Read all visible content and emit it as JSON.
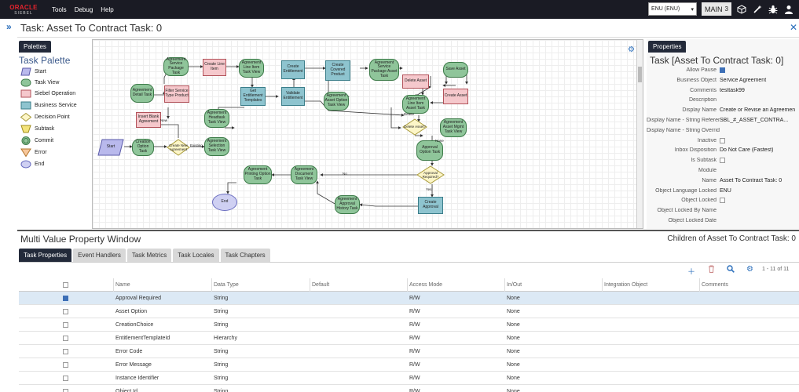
{
  "topbar": {
    "logo_line1": "ORACLE",
    "logo_line2": "SIEBEL",
    "menu": [
      "Tools",
      "Debug",
      "Help"
    ],
    "language": "ENU (ENU)",
    "main_label": "MAIN",
    "main_count": "3",
    "icons": [
      "cube-icon",
      "magic-wand-icon",
      "bug-icon",
      "user-icon"
    ]
  },
  "page": {
    "title": "Task: Asset To Contract Task: 0"
  },
  "palette": {
    "tab_label": "Palettes",
    "title": "Task Palette",
    "items": [
      {
        "label": "Start",
        "shape": "start"
      },
      {
        "label": "Task View",
        "shape": "taskview"
      },
      {
        "label": "Siebel Operation",
        "shape": "operation"
      },
      {
        "label": "Business Service",
        "shape": "service"
      },
      {
        "label": "Decision Point",
        "shape": "decision"
      },
      {
        "label": "Subtask",
        "shape": "subtask"
      },
      {
        "label": "Commit",
        "shape": "commit"
      },
      {
        "label": "Error",
        "shape": "error"
      },
      {
        "label": "End",
        "shape": "end"
      }
    ],
    "colors": {
      "taskview": "#8fc59a",
      "operation": "#f5c8cc",
      "service": "#8ec4cf",
      "decision": "#fdf6c8",
      "subtask": "#f3e37a",
      "error": "#f7c79b",
      "end": "#cfd0f2",
      "start": "#b9b9ec"
    }
  },
  "canvas": {
    "nodes": [
      {
        "id": "n_start",
        "label": "Start",
        "kind": "start"
      },
      {
        "id": "n_creation",
        "label": "Creation Option Task",
        "kind": "tv"
      },
      {
        "id": "n_createnew",
        "label": "Create New Agreement",
        "kind": "dp"
      },
      {
        "id": "n_agrsel",
        "label": "Agreement Selection Task View",
        "kind": "tv"
      },
      {
        "id": "n_insert",
        "label": "Insert Blank Agreement",
        "kind": "so"
      },
      {
        "id": "n_agrdetail",
        "label": "Agreement Detail Task",
        "kind": "tv"
      },
      {
        "id": "n_filter",
        "label": "Filter Service Type Product",
        "kind": "so"
      },
      {
        "id": "n_agrsvc",
        "label": "Agreement Service Package Task",
        "kind": "tv"
      },
      {
        "id": "n_createline",
        "label": "Create Line Item",
        "kind": "so"
      },
      {
        "id": "n_agrline",
        "label": "Agreement Line Item Task View",
        "kind": "tv"
      },
      {
        "id": "n_agrhead",
        "label": "Agreement Headtask Task View",
        "kind": "tv"
      },
      {
        "id": "n_getent",
        "label": "Get Entitlement Templates",
        "kind": "bs"
      },
      {
        "id": "n_createent",
        "label": "Create Entitlement",
        "kind": "bs"
      },
      {
        "id": "n_validate",
        "label": "Validate Entitlement",
        "kind": "bs"
      },
      {
        "id": "n_createcov",
        "label": "Create Covered Product",
        "kind": "bs"
      },
      {
        "id": "n_agropt",
        "label": "Agreement Asset Option Task View",
        "kind": "tv"
      },
      {
        "id": "n_svcpkg",
        "label": "Agreement Service Package Asset Task",
        "kind": "tv"
      },
      {
        "id": "n_delasset",
        "label": "Delete Asset",
        "kind": "so"
      },
      {
        "id": "n_saveasset",
        "label": "Save Asset",
        "kind": "tv"
      },
      {
        "id": "n_createasset",
        "label": "Create Asset",
        "kind": "so"
      },
      {
        "id": "n_lineasset",
        "label": "Agreement Line Item Asset Task",
        "kind": "tv"
      },
      {
        "id": "n_deleteq",
        "label": "Delete Asset?",
        "kind": "dp"
      },
      {
        "id": "n_mgmt",
        "label": "Agreement Asset Mgmt Task View",
        "kind": "tv"
      },
      {
        "id": "n_approvalopt",
        "label": "Approval Option Task",
        "kind": "tv"
      },
      {
        "id": "n_approvalreq",
        "label": "Approval Required?",
        "kind": "dp"
      },
      {
        "id": "n_createapp",
        "label": "Create Approval",
        "kind": "bs"
      },
      {
        "id": "n_apphist",
        "label": "Agreement Approval History Task",
        "kind": "tv"
      },
      {
        "id": "n_docview",
        "label": "Agreement Document Task View",
        "kind": "tv"
      },
      {
        "id": "n_printing",
        "label": "Agreement Printing Option Task",
        "kind": "tv"
      },
      {
        "id": "n_end",
        "label": "End",
        "kind": "nd"
      }
    ],
    "edge_labels": {
      "new": "New",
      "existing": "Existing",
      "delete": "Delete",
      "no": "No",
      "yes": "Yes",
      "none": "None"
    }
  },
  "properties": {
    "tab_label": "Properties",
    "title": "Task  [Asset To Contract Task: 0]",
    "rows": [
      {
        "label": "Allow Pause",
        "value": "",
        "check": "on"
      },
      {
        "label": "Business Object",
        "value": "Service Agreement"
      },
      {
        "label": "Comments",
        "value": "testtask99"
      },
      {
        "label": "Description",
        "value": ""
      },
      {
        "label": "Display Name",
        "value": "Create or Revise an Agreemen"
      },
      {
        "label": "Display Name - String Referenc",
        "value": "SBL_#_ASSET_CONTRA..."
      },
      {
        "label": "Display Name - String Override",
        "value": ""
      },
      {
        "label": "Inactive",
        "value": "",
        "check": "off"
      },
      {
        "label": "Inbox Disposition",
        "value": "Do Not Care (Fastest)"
      },
      {
        "label": "Is Subtask",
        "value": "",
        "check": "off"
      },
      {
        "label": "Module",
        "value": ""
      },
      {
        "label": "Name",
        "value": "Asset To Contract Task: 0"
      },
      {
        "label": "Object Language Locked",
        "value": "ENU"
      },
      {
        "label": "Object Locked",
        "value": "",
        "check": "off"
      },
      {
        "label": "Object Locked By Name",
        "value": ""
      },
      {
        "label": "Object Locked Date",
        "value": ""
      }
    ]
  },
  "bottom": {
    "title": "Multi Value Property Window",
    "children_label": "Children of Asset To Contract Task: 0",
    "tabs": [
      "Task Properties",
      "Event Handlers",
      "Task Metrics",
      "Task Locales",
      "Task Chapters"
    ],
    "active_tab": 0,
    "pager": "1 - 11 of 11",
    "columns": [
      "Name",
      "Data Type",
      "Default",
      "Access Mode",
      "In/Out",
      "Integration Object",
      "Comments"
    ],
    "rows": [
      {
        "checked": true,
        "name": "Approval Required",
        "type": "String",
        "default": "",
        "access": "R/W",
        "inout": "None",
        "io": "",
        "comments": ""
      },
      {
        "checked": false,
        "name": "Asset Option",
        "type": "String",
        "default": "",
        "access": "R/W",
        "inout": "None",
        "io": "",
        "comments": ""
      },
      {
        "checked": false,
        "name": "CreationChoice",
        "type": "String",
        "default": "",
        "access": "R/W",
        "inout": "None",
        "io": "",
        "comments": ""
      },
      {
        "checked": false,
        "name": "EntitlementTemplateId",
        "type": "Hierarchy",
        "default": "",
        "access": "R/W",
        "inout": "None",
        "io": "",
        "comments": ""
      },
      {
        "checked": false,
        "name": "Error Code",
        "type": "String",
        "default": "",
        "access": "R/W",
        "inout": "None",
        "io": "",
        "comments": ""
      },
      {
        "checked": false,
        "name": "Error Message",
        "type": "String",
        "default": "",
        "access": "R/W",
        "inout": "None",
        "io": "",
        "comments": ""
      },
      {
        "checked": false,
        "name": "Instance Identifier",
        "type": "String",
        "default": "",
        "access": "R/W",
        "inout": "None",
        "io": "",
        "comments": ""
      },
      {
        "checked": false,
        "name": "Object Id",
        "type": "String",
        "default": "",
        "access": "R/W",
        "inout": "None",
        "io": "",
        "comments": ""
      }
    ]
  }
}
